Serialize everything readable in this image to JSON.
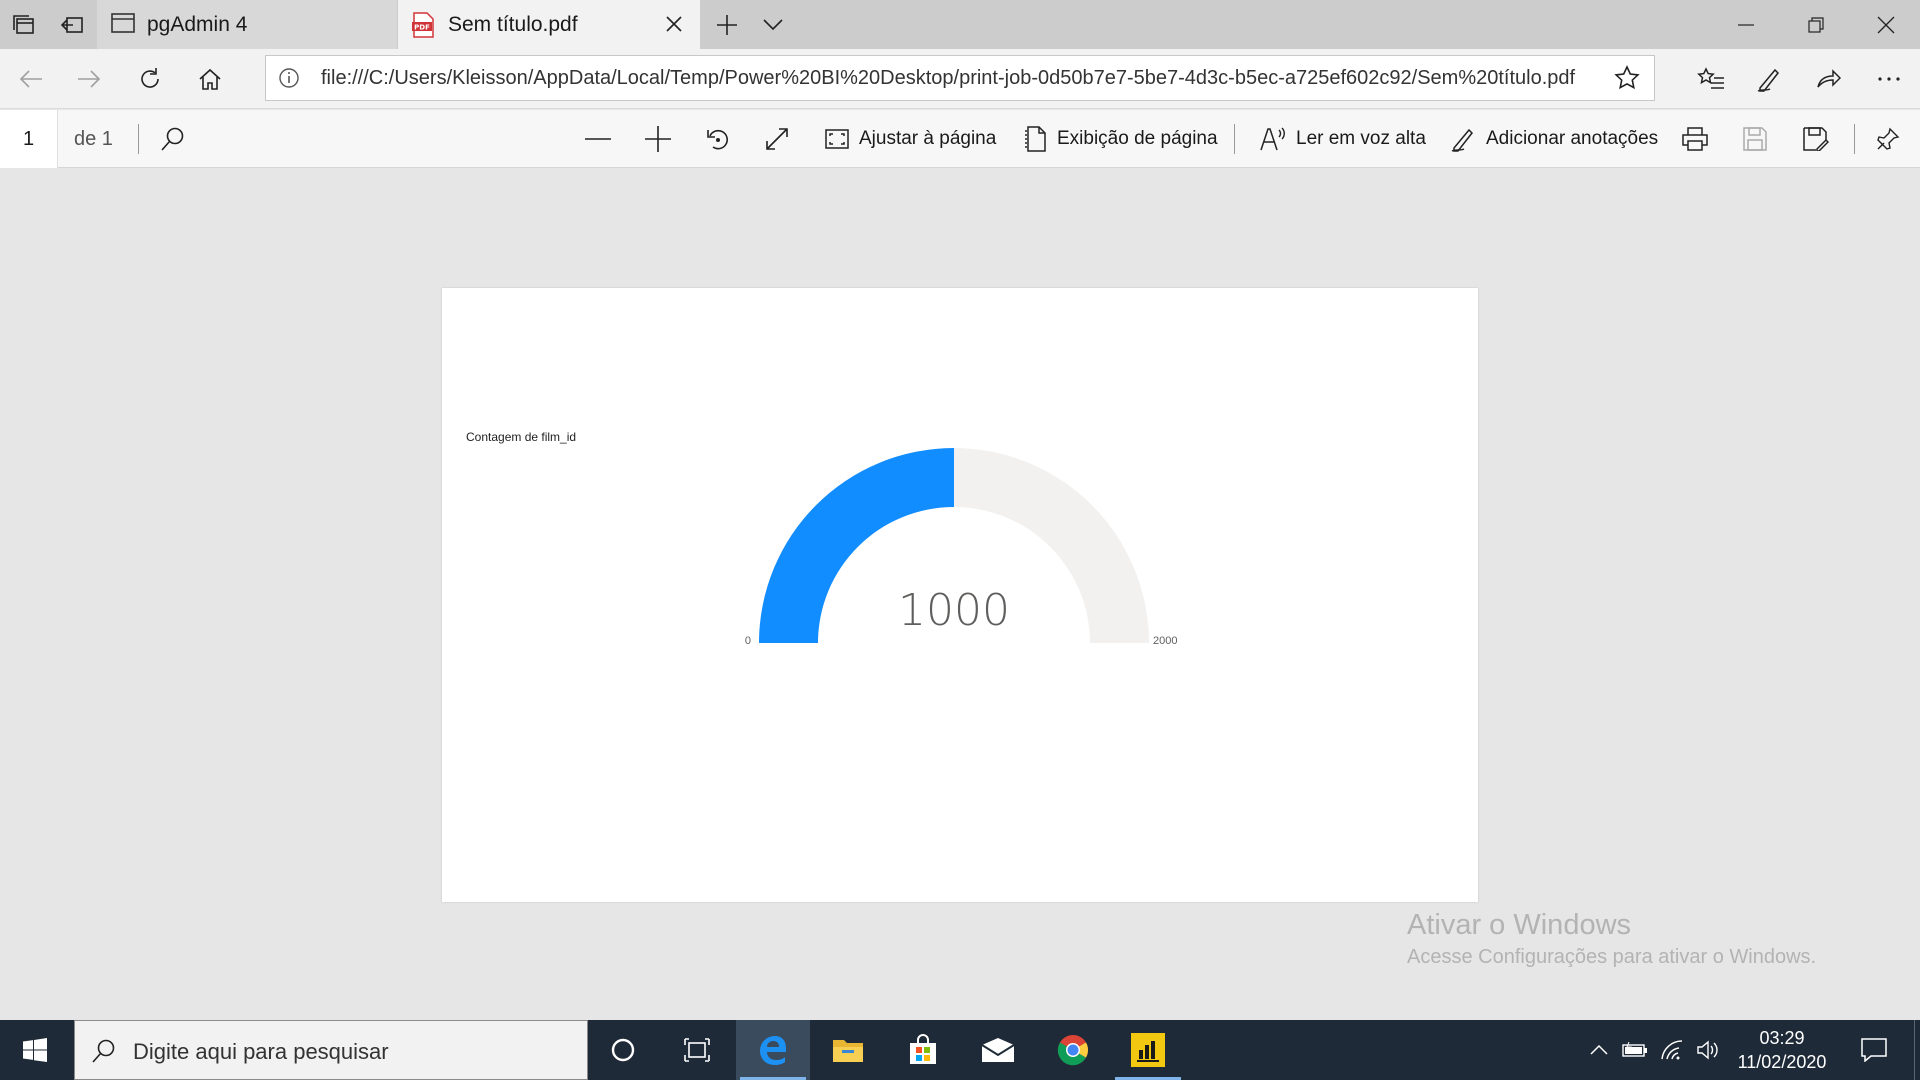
{
  "browser": {
    "tabs": [
      {
        "title": "pgAdmin 4",
        "active": false
      },
      {
        "title": "Sem título.pdf",
        "active": true
      }
    ],
    "address": {
      "url": "file:///C:/Users/Kleisson/AppData/Local/Temp/Power%20BI%20Desktop/print-job-0d50b7e7-5be7-4d3c-b5ec-a725ef602c92/Sem%20título.pdf"
    }
  },
  "pdf_toolbar": {
    "page_number": "1",
    "page_of": "de 1",
    "fit_page_label": "Ajustar à página",
    "page_view_label": "Exibição de página",
    "read_aloud_label": "Ler em voz alta",
    "add_notes_label": "Adicionar anotações"
  },
  "report": {
    "visual_title": "Contagem de film_id"
  },
  "chart_data": {
    "type": "gauge",
    "value": 1000,
    "value_label": "1000",
    "min": 0,
    "max": 2000,
    "min_label": "0",
    "max_label": "2000",
    "fill_color": "#118dff",
    "track_color": "#f2f1f0"
  },
  "watermark": {
    "title": "Ativar o Windows",
    "subtitle": "Acesse Configurações para ativar o Windows."
  },
  "taskbar": {
    "search_placeholder": "Digite aqui para pesquisar",
    "apps": [
      "cortana-icon",
      "task-view-icon",
      "edge-icon",
      "file-explorer-icon",
      "store-icon",
      "mail-icon",
      "chrome-icon",
      "power-bi-icon"
    ],
    "time": "03:29",
    "date": "11/02/2020"
  },
  "colors": {
    "accent": "#118dff",
    "taskbar": "#1f2a38"
  }
}
